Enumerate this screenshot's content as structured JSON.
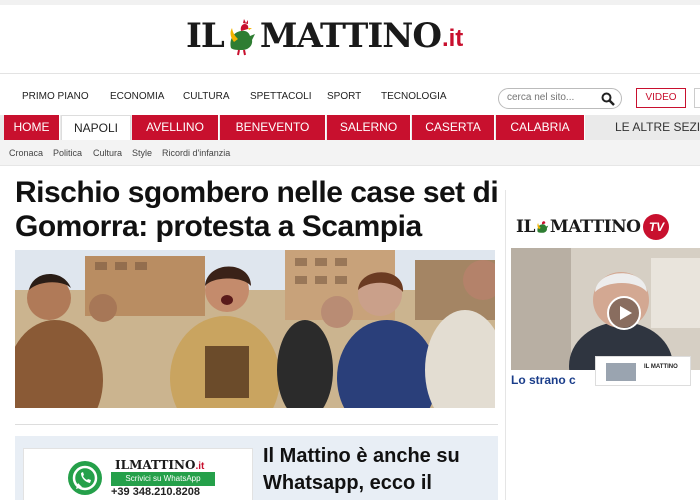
{
  "masthead": {
    "logo_left": "IL",
    "logo_right": "MATTINO",
    "logo_tld": ".it"
  },
  "section_nav": {
    "items": [
      "PRIMO PIANO",
      "ECONOMIA",
      "CULTURA",
      "SPETTACOLI",
      "SPORT",
      "TECNOLOGIA"
    ],
    "search_placeholder": "cerca nel sito...",
    "video_button": "VIDEO"
  },
  "city_nav": {
    "items": [
      "HOME",
      "NAPOLI",
      "AVELLINO",
      "BENEVENTO",
      "SALERNO",
      "CASERTA",
      "CALABRIA"
    ],
    "active": "NAPOLI",
    "more": "LE ALTRE SEZIONI"
  },
  "sub_nav": {
    "items": [
      "Cronaca",
      "Politica",
      "Cultura",
      "Style",
      "Ricordi d'infanzia"
    ]
  },
  "article": {
    "headline": "Rischio sgombero nelle case set di Gomorra: protesta a Scampia"
  },
  "promo": {
    "card_logo_left": "IL",
    "card_logo_right": "MATTINO",
    "card_logo_tld": ".it",
    "cta": "Scrivici su WhatsApp",
    "phone": "+39 348.210.8208",
    "title": "Il Mattino è anche su Whatsapp, ecco il"
  },
  "sidebar": {
    "tv_logo_left": "IL",
    "tv_logo_right": "MATTINO",
    "tv_badge": "TV",
    "thumb_label": "IL MATTINO",
    "video_caption": "Lo strano c"
  },
  "colors": {
    "brand_red": "#c8102e",
    "whatsapp_green": "#25a04a",
    "link_blue": "#1a3d8a"
  },
  "icons": {
    "search": "magnifier-icon",
    "play": "play-icon",
    "whatsapp": "whatsapp-icon",
    "rooster": "rooster-logo-icon"
  }
}
